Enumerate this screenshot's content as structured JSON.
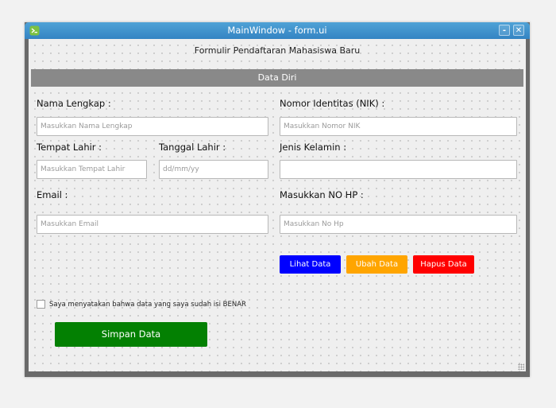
{
  "window": {
    "title": "MainWindow - form.ui",
    "minimize_glyph": "-",
    "close_glyph": "✕"
  },
  "form": {
    "heading": "Formulir Pendaftaran Mahasiswa Baru",
    "section_title": "Data Diri",
    "fields": {
      "nama": {
        "label": "Nama Lengkap :",
        "placeholder": "Masukkan Nama Lengkap",
        "value": ""
      },
      "nik": {
        "label": "Nomor  Identitas (NIK) :",
        "placeholder": "Masukkan Nomor NIK",
        "value": ""
      },
      "tempat_lahir": {
        "label": "Tempat Lahir :",
        "placeholder": "Masukkan Tempat Lahir",
        "value": ""
      },
      "tanggal_lahir": {
        "label": "Tanggal Lahir :",
        "placeholder": "dd/mm/yy",
        "value": ""
      },
      "jenis_kelamin": {
        "label": "Jenis Kelamin :",
        "placeholder": "",
        "value": ""
      },
      "email": {
        "label": "Email :",
        "placeholder": "Masukkan Email",
        "value": ""
      },
      "no_hp": {
        "label": "Masukkan NO HP :",
        "placeholder": "Masukkan No Hp",
        "value": ""
      }
    },
    "buttons": {
      "lihat": {
        "label": "Lihat Data",
        "color": "#0000ff"
      },
      "ubah": {
        "label": "Ubah Data",
        "color": "#ffa500"
      },
      "hapus": {
        "label": "Hapus Data",
        "color": "#ff0000"
      },
      "simpan": {
        "label": "Simpan Data",
        "color": "#038002"
      }
    },
    "agreement": {
      "label": "Saya menyatakan bahwa data yang saya sudah isi  BENAR",
      "checked": false
    }
  },
  "colors": {
    "titlebar": "#3b8ccb",
    "section_bar": "#898989"
  }
}
